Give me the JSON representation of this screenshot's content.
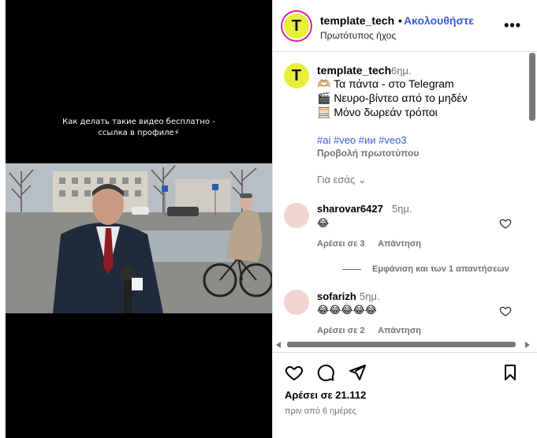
{
  "media": {
    "overlay_line1": "Как делать такие видео бесплатно -",
    "overlay_line2": "ссылка в профиле⚡"
  },
  "header": {
    "username": "template_tech",
    "separator": "•",
    "follow_label": "Ακολουθήστε",
    "audio_label": "Πρωτότυπος ήχος",
    "avatar_letter": "T"
  },
  "post": {
    "username": "template_tech",
    "time": "6ημ.",
    "lines": [
      "🫶🏼 Τα πάντα - στο Telegram",
      "🎬 Νευρο-βίντεο από το μηδέν",
      "🧮 Μόνο δωρεάν τρόποι"
    ],
    "hashtags": "#ai #veo #ии #veo3",
    "translation_label": "Προβολή πρωτοτύπου",
    "for_you_label": "Για εσάς ⌄"
  },
  "comments": [
    {
      "username": "sharovar6427",
      "time": "5ημ.",
      "text": "😂",
      "likes_label": "Αρέσει σε 3",
      "reply_label": "Απάντηση"
    },
    {
      "username": "sofarizh",
      "time": "5ημ.",
      "text": "😂😂😂😂😂",
      "likes_label": "Αρέσει σε 2",
      "reply_label": "Απάντηση"
    }
  ],
  "view_replies_label": "Εμφάνιση και των 1 απαντήσεων",
  "footer": {
    "likes_label": "Αρέσει σε 21.112",
    "date_label": "πριν από 6 ημέρες"
  },
  "colors": {
    "link": "#3a5bd9",
    "avatar_bg": "#e7ef3a",
    "muted": "#737373"
  }
}
